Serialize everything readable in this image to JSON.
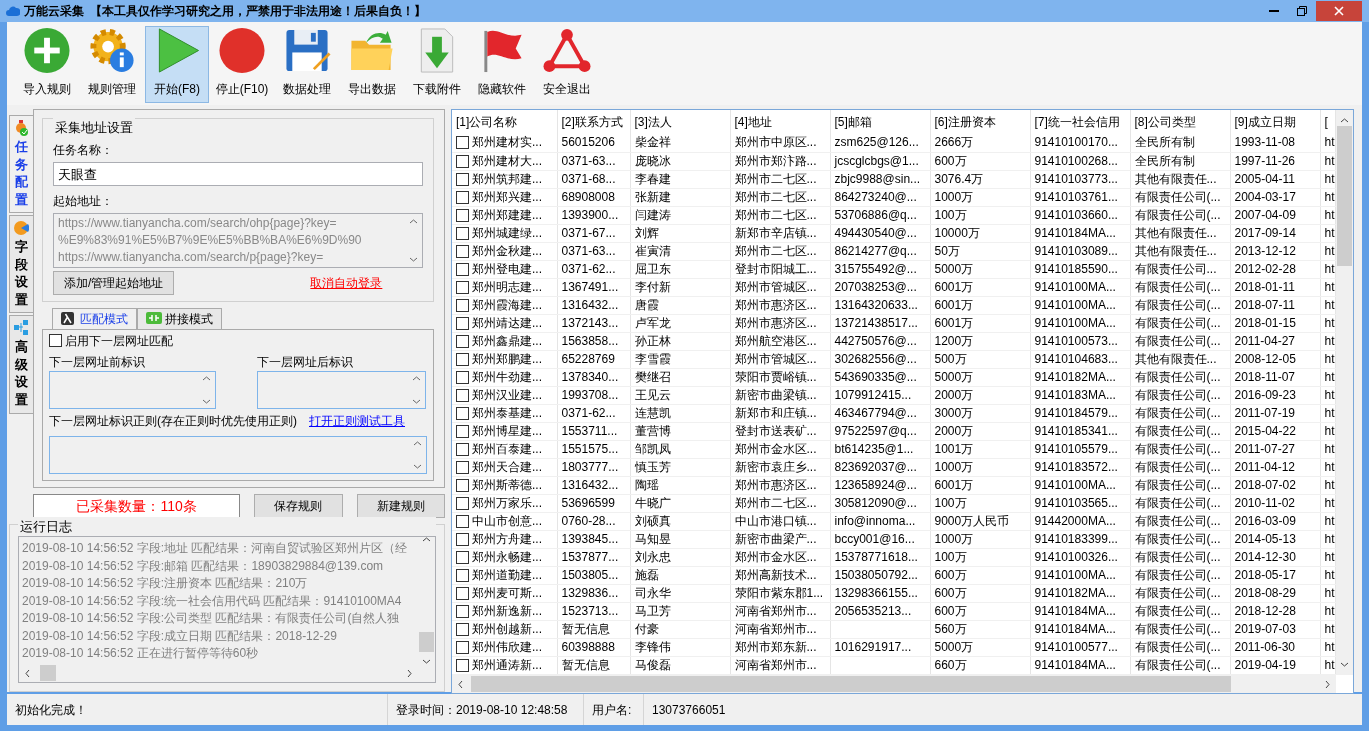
{
  "window": {
    "title": "万能云采集",
    "notice": "【本工具仅作学习研究之用，严禁用于非法用途！后果自负！】"
  },
  "toolbar": [
    {
      "label": "导入规则",
      "kind": "plus",
      "selected": false
    },
    {
      "label": "规则管理",
      "kind": "gear",
      "selected": false
    },
    {
      "label": "开始(F8)",
      "kind": "play",
      "selected": true
    },
    {
      "label": "停止(F10)",
      "kind": "stop",
      "selected": false
    },
    {
      "label": "数据处理",
      "kind": "disk",
      "selected": false
    },
    {
      "label": "导出数据",
      "kind": "folder",
      "selected": false
    },
    {
      "label": "下载附件",
      "kind": "download",
      "selected": false
    },
    {
      "label": "隐藏软件",
      "kind": "flag",
      "selected": false
    },
    {
      "label": "安全退出",
      "kind": "exit",
      "selected": false
    }
  ],
  "side_tabs": [
    {
      "label": "任务配置",
      "kind": "task",
      "selected": true
    },
    {
      "label": "字段设置",
      "kind": "field",
      "selected": false
    },
    {
      "label": "高级设置",
      "kind": "advanced",
      "selected": false
    }
  ],
  "address_group": {
    "title": "采集地址设置",
    "task_name_label": "任务名称：",
    "task_name": "天眼查",
    "start_url_label": "起始地址：",
    "start_urls": [
      "https://www.tianyancha.com/search/ohp{page}?key=",
      "%E9%83%91%E5%B7%9E%E5%BB%BA%E6%9D%90",
      "https://www.tianyancha.com/search/p{page}?key="
    ],
    "manage_button": "添加/管理起始地址",
    "cancel_login_link": "取消自动登录"
  },
  "mode_tabs": [
    {
      "label": "匹配模式",
      "kind": "match",
      "selected": true
    },
    {
      "label": "拼接模式",
      "kind": "join",
      "selected": false
    }
  ],
  "match_panel": {
    "enable_label": "启用下一层网址匹配",
    "enable_checked": false,
    "prefix_label": "下一层网址前标识",
    "suffix_label": "下一层网址后标识",
    "regex_label": "下一层网址标识正则(存在正则时优先使用正则)",
    "regex_tool_link": "打开正则测试工具"
  },
  "collected_count": "已采集数量：110条",
  "save_button": "保存规则",
  "new_button": "新建规则",
  "log": {
    "title": "运行日志",
    "lines": [
      "2019-08-10 14:56:52 字段:地址 匹配结果：河南自贸试验区郑州片区（经",
      "2019-08-10 14:56:52 字段:邮箱 匹配结果：18903829884@139.com",
      "2019-08-10 14:56:52 字段:注册资本 匹配结果：210万",
      "2019-08-10 14:56:52 字段:统一社会信用代码 匹配结果：91410100MA4",
      "2019-08-10 14:56:52 字段:公司类型 匹配结果：有限责任公司(自然人独",
      "2019-08-10 14:56:52 字段:成立日期 匹配结果：2018-12-29",
      "2019-08-10 14:56:52 正在进行暂停等待60秒"
    ]
  },
  "table": {
    "columns": [
      "[1]公司名称",
      "[2]联系方式",
      "[3]法人",
      "[4]地址",
      "[5]邮箱",
      "[6]注册资本",
      "[7]统一社会信用",
      "[8]公司类型",
      "[9]成立日期",
      "["
    ],
    "rows": [
      {
        "checked": false,
        "cells": [
          "郑州建材实...",
          "56015206",
          "柴金祥",
          "郑州市中原区...",
          "zsm625@126...",
          "2666万",
          "91410100170...",
          "全民所有制",
          "1993-11-08",
          "ht"
        ]
      },
      {
        "checked": false,
        "cells": [
          "郑州建材大...",
          "0371-63...",
          "庞晓冰",
          "郑州市郑汴路...",
          "jcscglcbgs@1...",
          "600万",
          "91410100268...",
          "全民所有制",
          "1997-11-26",
          "ht"
        ]
      },
      {
        "checked": false,
        "cells": [
          "郑州筑邦建...",
          "0371-68...",
          "李春建",
          "郑州市二七区...",
          "zbjc9988@sin...",
          "3076.4万",
          "91410103773...",
          "其他有限责任...",
          "2005-04-11",
          "ht"
        ]
      },
      {
        "checked": false,
        "cells": [
          "郑州郑兴建...",
          "68908008",
          "张新建",
          "郑州市二七区...",
          "864273240@...",
          "1000万",
          "91410103761...",
          "有限责任公司(...",
          "2004-03-17",
          "ht"
        ]
      },
      {
        "checked": false,
        "cells": [
          "郑州郑建建...",
          "1393900...",
          "闫建涛",
          "郑州市二七区...",
          "53706886@q...",
          "100万",
          "91410103660...",
          "有限责任公司(...",
          "2007-04-09",
          "ht"
        ]
      },
      {
        "checked": false,
        "cells": [
          "郑州城建绿...",
          "0371-67...",
          "刘辉",
          "新郑市辛店镇...",
          "494430540@...",
          "10000万",
          "91410184MA...",
          "其他有限责任...",
          "2017-09-14",
          "ht"
        ]
      },
      {
        "checked": false,
        "cells": [
          "郑州金秋建...",
          "0371-63...",
          "崔寅清",
          "郑州市二七区...",
          "86214277@q...",
          "50万",
          "91410103089...",
          "其他有限责任...",
          "2013-12-12",
          "ht"
        ]
      },
      {
        "checked": false,
        "cells": [
          "郑州登电建...",
          "0371-62...",
          "屈卫东",
          "登封市阳城工...",
          "315755492@...",
          "5000万",
          "91410185590...",
          "有限责任公司...",
          "2012-02-28",
          "ht"
        ]
      },
      {
        "checked": false,
        "cells": [
          "郑州明志建...",
          "1367491...",
          "李付新",
          "郑州市管城区...",
          "207038253@...",
          "6001万",
          "91410100MA...",
          "有限责任公司(...",
          "2018-01-11",
          "ht"
        ]
      },
      {
        "checked": false,
        "cells": [
          "郑州霞海建...",
          "1316432...",
          "唐霞",
          "郑州市惠济区...",
          "13164320633...",
          "6001万",
          "91410100MA...",
          "有限责任公司(...",
          "2018-07-11",
          "ht"
        ]
      },
      {
        "checked": false,
        "cells": [
          "郑州靖达建...",
          "1372143...",
          "卢军龙",
          "郑州市惠济区...",
          "13721438517...",
          "6001万",
          "91410100MA...",
          "有限责任公司(...",
          "2018-01-15",
          "ht"
        ]
      },
      {
        "checked": false,
        "cells": [
          "郑州鑫鼎建...",
          "1563858...",
          "孙正林",
          "郑州航空港区...",
          "442750576@...",
          "1200万",
          "91410100573...",
          "有限责任公司(...",
          "2011-04-27",
          "ht"
        ]
      },
      {
        "checked": false,
        "cells": [
          "郑州郑鹏建...",
          "65228769",
          "李雪霞",
          "郑州市管城区...",
          "302682556@...",
          "500万",
          "91410104683...",
          "其他有限责任...",
          "2008-12-05",
          "ht"
        ]
      },
      {
        "checked": false,
        "cells": [
          "郑州牛劲建...",
          "1378340...",
          "樊继召",
          "荥阳市贾峪镇...",
          "543690335@...",
          "5000万",
          "91410182MA...",
          "有限责任公司(...",
          "2018-11-07",
          "ht"
        ]
      },
      {
        "checked": false,
        "cells": [
          "郑州汉业建...",
          "1993708...",
          "王见云",
          "新密市曲梁镇...",
          "1079912415...",
          "2000万",
          "91410183MA...",
          "有限责任公司(...",
          "2016-09-23",
          "ht"
        ]
      },
      {
        "checked": false,
        "cells": [
          "郑州泰基建...",
          "0371-62...",
          "连慧凯",
          "新郑市和庄镇...",
          "463467794@...",
          "3000万",
          "91410184579...",
          "有限责任公司(...",
          "2011-07-19",
          "ht"
        ]
      },
      {
        "checked": false,
        "cells": [
          "郑州博星建...",
          "1553711...",
          "董营博",
          "登封市送表矿...",
          "97522597@q...",
          "2000万",
          "91410185341...",
          "有限责任公司(...",
          "2015-04-22",
          "ht"
        ]
      },
      {
        "checked": false,
        "cells": [
          "郑州百泰建...",
          "1551575...",
          "邹凯凤",
          "郑州市金水区...",
          "bt614235@1...",
          "1001万",
          "91410105579...",
          "有限责任公司(...",
          "2011-07-27",
          "ht"
        ]
      },
      {
        "checked": false,
        "cells": [
          "郑州天合建...",
          "1803777...",
          "慎玉芳",
          "新密市袁庄乡...",
          "823692037@...",
          "1000万",
          "91410183572...",
          "有限责任公司(...",
          "2011-04-12",
          "ht"
        ]
      },
      {
        "checked": false,
        "cells": [
          "郑州斯蒂德...",
          "1316432...",
          "陶瑶",
          "郑州市惠济区...",
          "123658924@...",
          "6001万",
          "91410100MA...",
          "有限责任公司(...",
          "2018-07-02",
          "ht"
        ]
      },
      {
        "checked": false,
        "cells": [
          "郑州万家乐...",
          "53696599",
          "牛晓广",
          "郑州市二七区...",
          "305812090@...",
          "100万",
          "91410103565...",
          "有限责任公司(...",
          "2010-11-02",
          "ht"
        ]
      },
      {
        "checked": false,
        "cells": [
          "中山市创意...",
          "0760-28...",
          "刘硕真",
          "中山市港口镇...",
          "info@innoma...",
          "9000万人民币",
          "91442000MA...",
          "有限责任公司(...",
          "2016-03-09",
          "ht"
        ]
      },
      {
        "checked": false,
        "cells": [
          "郑州方舟建...",
          "1393845...",
          "马知昱",
          "新密市曲梁产...",
          "bccy001@16...",
          "1000万",
          "91410183399...",
          "有限责任公司(...",
          "2014-05-13",
          "ht"
        ]
      },
      {
        "checked": false,
        "cells": [
          "郑州永畅建...",
          "1537877...",
          "刘永忠",
          "郑州市金水区...",
          "15378771618...",
          "100万",
          "91410100326...",
          "有限责任公司(...",
          "2014-12-30",
          "ht"
        ]
      },
      {
        "checked": false,
        "cells": [
          "郑州道勤建...",
          "1503805...",
          "施磊",
          "郑州高新技术...",
          "15038050792...",
          "600万",
          "91410100MA...",
          "有限责任公司(...",
          "2018-05-17",
          "ht"
        ]
      },
      {
        "checked": false,
        "cells": [
          "郑州麦可斯...",
          "1329836...",
          "司永华",
          "荥阳市紫东郡1...",
          "13298366155...",
          "600万",
          "91410182MA...",
          "有限责任公司(...",
          "2018-08-29",
          "ht"
        ]
      },
      {
        "checked": false,
        "cells": [
          "郑州新逸新...",
          "1523713...",
          "马卫芳",
          "河南省郑州市...",
          "2056535213...",
          "600万",
          "91410184MA...",
          "有限责任公司(...",
          "2018-12-28",
          "ht"
        ]
      },
      {
        "checked": false,
        "cells": [
          "郑州创越新...",
          "暂无信息",
          "付豪",
          "河南省郑州市...",
          null,
          "560万",
          "91410184MA...",
          "有限责任公司(...",
          "2019-07-03",
          "ht"
        ]
      },
      {
        "checked": false,
        "cells": [
          "郑州伟欣建...",
          "60398888",
          "李锋伟",
          "郑州市郑东新...",
          "1016291917...",
          "5000万",
          "91410100577...",
          "有限责任公司(...",
          "2011-06-30",
          "ht"
        ]
      },
      {
        "checked": false,
        "cells": [
          "郑州通涛新...",
          "暂无信息",
          "马俊磊",
          "河南省郑州市...",
          null,
          "660万",
          "91410184MA...",
          "有限责任公司(...",
          "2019-04-19",
          "ht"
        ]
      }
    ]
  },
  "status_bar": {
    "message": "初始化完成！",
    "login_time": "登录时间：2019-08-10 12:48:58",
    "user_label": "用户名:",
    "user": "13073766051"
  }
}
